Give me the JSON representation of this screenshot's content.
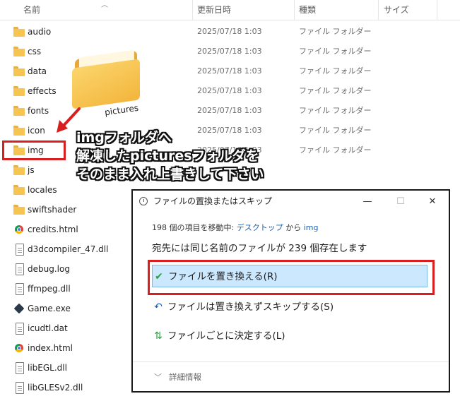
{
  "header": {
    "col_name": "名前",
    "col_date": "更新日時",
    "col_type": "種類",
    "col_size": "サイズ"
  },
  "files": [
    {
      "name": "audio",
      "date": "2025/07/18 1:03",
      "type": "ファイル フォルダー",
      "icon": "folder-icon"
    },
    {
      "name": "css",
      "date": "2025/07/18 1:03",
      "type": "ファイル フォルダー",
      "icon": "folder-icon"
    },
    {
      "name": "data",
      "date": "2025/07/18 1:03",
      "type": "ファイル フォルダー",
      "icon": "folder-icon"
    },
    {
      "name": "effects",
      "date": "2025/07/18 1:03",
      "type": "ファイル フォルダー",
      "icon": "folder-icon"
    },
    {
      "name": "fonts",
      "date": "2025/07/18 1:03",
      "type": "ファイル フォルダー",
      "icon": "folder-icon"
    },
    {
      "name": "icon",
      "date": "2025/07/18 1:03",
      "type": "ファイル フォルダー",
      "icon": "folder-icon"
    },
    {
      "name": "img",
      "date": "2025/07/18 1:03",
      "type": "ファイル フォルダー",
      "icon": "folder-icon"
    },
    {
      "name": "js",
      "date": "",
      "type": "",
      "icon": "folder-icon"
    },
    {
      "name": "locales",
      "date": "",
      "type": "",
      "icon": "folder-icon"
    },
    {
      "name": "swiftshader",
      "date": "",
      "type": "",
      "icon": "folder-icon"
    },
    {
      "name": "credits.html",
      "date": "",
      "type": "",
      "icon": "chrome-icon"
    },
    {
      "name": "d3dcompiler_47.dll",
      "date": "",
      "type": "",
      "icon": "dll-file-icon"
    },
    {
      "name": "debug.log",
      "date": "",
      "type": "",
      "icon": "text-file-icon"
    },
    {
      "name": "ffmpeg.dll",
      "date": "",
      "type": "",
      "icon": "dll-file-icon"
    },
    {
      "name": "Game.exe",
      "date": "",
      "type": "",
      "icon": "game-icon"
    },
    {
      "name": "icudtl.dat",
      "date": "",
      "type": "",
      "icon": "file-icon"
    },
    {
      "name": "index.html",
      "date": "",
      "type": "",
      "icon": "chrome-icon"
    },
    {
      "name": "libEGL.dll",
      "date": "",
      "type": "",
      "icon": "dll-file-icon"
    },
    {
      "name": "libGLESv2.dll",
      "date": "",
      "type": "",
      "icon": "dll-file-icon"
    }
  ],
  "illustration": {
    "folder_label": "pictures"
  },
  "annotation": {
    "line1": "imgフォルダへ",
    "line2": "解凍したpicturesフォルダを",
    "line3": "そのまま入れ上書きして下さい"
  },
  "dialog": {
    "title": "ファイルの置換またはスキップ",
    "minimize": "—",
    "maximize": "☐",
    "close": "✕",
    "sub_count": "198 個の項目を移動中:",
    "sub_from": "デスクトップ",
    "sub_mid": "から",
    "sub_to": "img",
    "main_text": "宛先には同じ名前のファイルが 239 個存在します",
    "option_replace": "ファイルを置き換える(R)",
    "option_skip": "ファイルは置き換えずスキップする(S)",
    "option_decide": "ファイルごとに決定する(L)",
    "details": "詳細情報"
  },
  "colors": {
    "highlight_red": "#d81e1e",
    "selection_blue": "#cce8ff",
    "link_blue": "#1a5fb4",
    "folder_yellow": "#f5c451"
  }
}
